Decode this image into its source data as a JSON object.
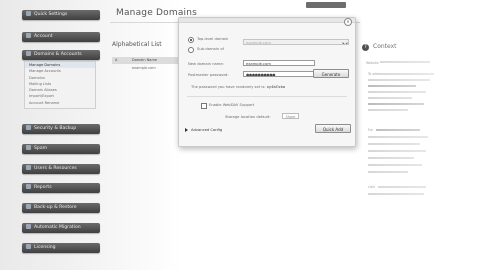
{
  "page": {
    "title": "Manage Domains"
  },
  "sidebar": {
    "blocks": [
      {
        "label": "Quick Settings"
      },
      {
        "label": "Account"
      },
      {
        "label": "Domains & Accounts"
      },
      {
        "label": "Security & Backup"
      },
      {
        "label": "Spam"
      },
      {
        "label": "Users & Resources"
      },
      {
        "label": "Reports"
      },
      {
        "label": "Back-up & Restore"
      },
      {
        "label": "Automatic Migration"
      },
      {
        "label": "Licensing"
      }
    ],
    "sub_items": [
      "Manage Domains",
      "Manage Accounts",
      "Domains",
      "Mailing Lists",
      "Domain Aliases",
      "Import/Export",
      "Account Rename"
    ]
  },
  "list": {
    "alpha_label": "Alphabetical List",
    "alpha_muted": "",
    "col_marker": "A",
    "col_name": "Domain Name",
    "row_name": "example.com"
  },
  "dialog": {
    "close_glyph": "×",
    "radio_top_label": "Top-level domain",
    "radio_sub_label": "Sub-domain of",
    "sub_domain_select": "example.com",
    "name_label": "New domain name:",
    "name_value": "example.com",
    "password_label": "Postmaster password:",
    "password_value": "●●●●●●●●●●",
    "generate_button": "Generate",
    "password_note": "The password you have randomly set is:",
    "password_generated": "xy4bOcka",
    "checkbox_label": "Enable WebDAV Support",
    "storage_label": "Storage location default:",
    "storage_value": "Share",
    "advanced_label": "Advanced Config",
    "add_button": "Quick Add"
  },
  "context": {
    "icon_glyph": "?",
    "title": "Context",
    "words": [
      "Website",
      "To add",
      "For",
      "click"
    ]
  }
}
